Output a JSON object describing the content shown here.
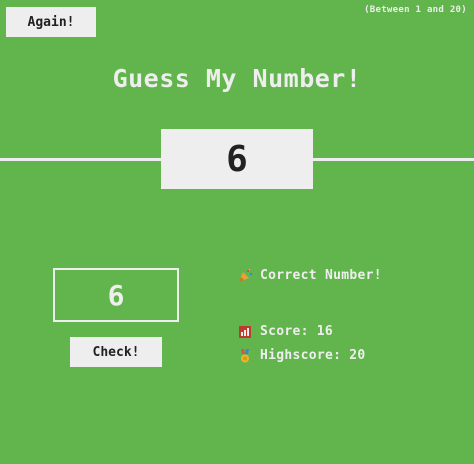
{
  "header": {
    "again_label": "Again!",
    "range_hint": "(Between 1 and 20)"
  },
  "title": "Guess My Number!",
  "secret_number": "6",
  "guess": {
    "value": "6"
  },
  "check_label": "Check!",
  "message": {
    "icon": "party-popper-icon",
    "text": "Correct Number!"
  },
  "score": {
    "icon": "chart-icon",
    "label": "Score:",
    "value": "16"
  },
  "highscore": {
    "icon": "medal-icon",
    "label": "Highscore:",
    "value": "20"
  },
  "colors": {
    "background": "#62b54d",
    "foreground": "#eeeeee",
    "text_dark": "#222222"
  }
}
